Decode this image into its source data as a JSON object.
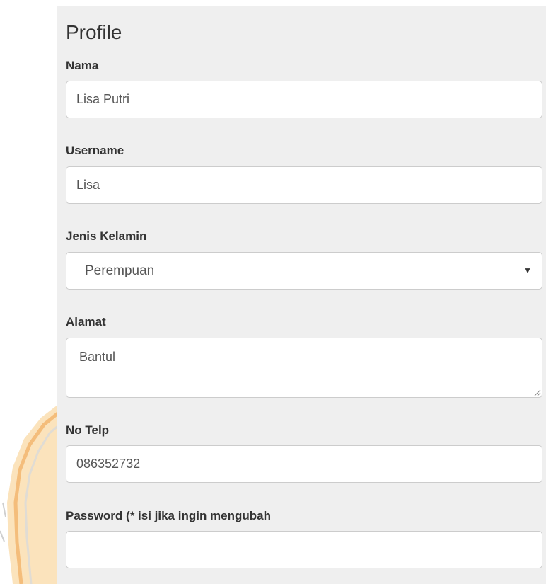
{
  "form": {
    "title": "Profile",
    "fields": {
      "nama": {
        "label": "Nama",
        "value": "Lisa Putri"
      },
      "username": {
        "label": "Username",
        "value": "Lisa"
      },
      "jenis_kelamin": {
        "label": "Jenis Kelamin",
        "selected": "Perempuan"
      },
      "alamat": {
        "label": "Alamat",
        "value": "Bantul"
      },
      "no_telp": {
        "label": "No Telp",
        "value": "086352732"
      },
      "password": {
        "label": "Password (* isi jika ingin mengubah",
        "value": ""
      }
    }
  },
  "icons": {
    "select_arrow": "▼",
    "textarea_resize": "resize-grip-icon"
  },
  "colors": {
    "panel_background": "#efefef",
    "input_border": "#cccccc",
    "watermark": "#f5a623"
  }
}
